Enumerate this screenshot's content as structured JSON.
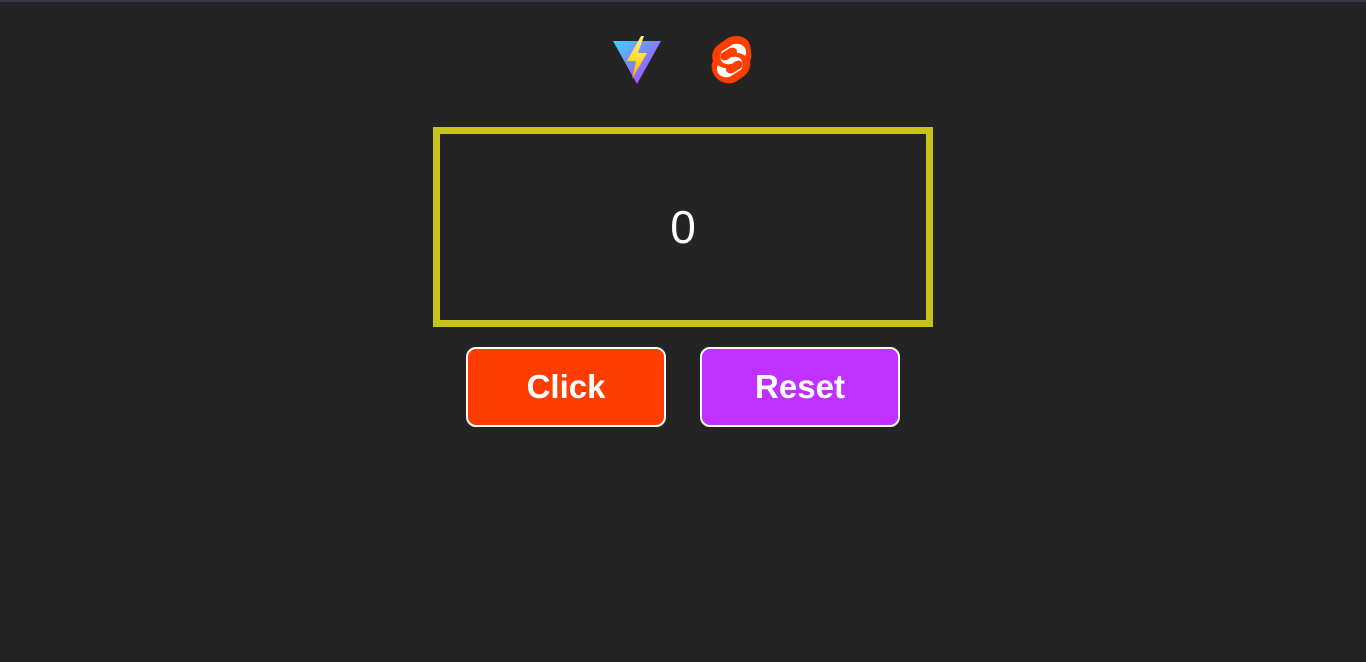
{
  "logos": {
    "vite_icon": "vite-logo",
    "svelte_icon": "svelte-logo"
  },
  "counter": {
    "value": "0"
  },
  "buttons": {
    "click_label": "Click",
    "reset_label": "Reset"
  },
  "colors": {
    "background": "#242424",
    "counter_border": "#c9c21a",
    "click_button": "#ff3d00",
    "reset_button": "#c030ff",
    "svelte": "#ff3e00"
  }
}
